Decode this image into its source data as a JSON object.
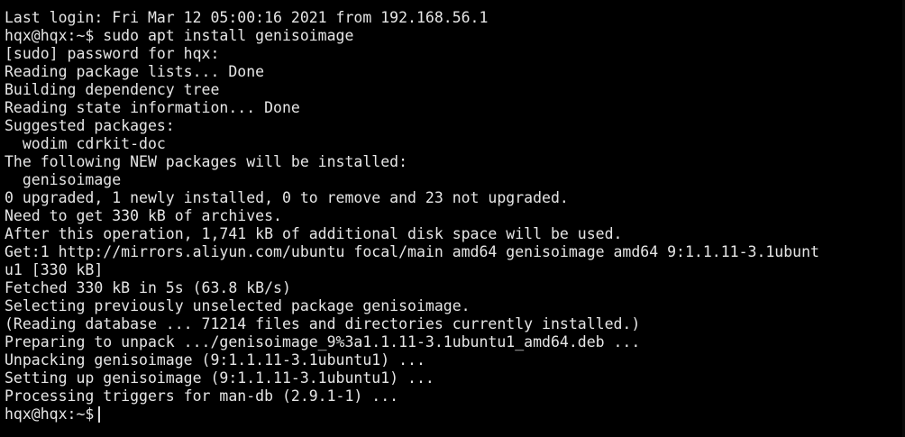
{
  "terminal": {
    "lines": [
      "Last login: Fri Mar 12 05:00:16 2021 from 192.168.56.1",
      "hqx@hqx:~$ sudo apt install genisoimage",
      "[sudo] password for hqx:",
      "Reading package lists... Done",
      "Building dependency tree",
      "Reading state information... Done",
      "Suggested packages:",
      "  wodim cdrkit-doc",
      "The following NEW packages will be installed:",
      "  genisoimage",
      "0 upgraded, 1 newly installed, 0 to remove and 23 not upgraded.",
      "Need to get 330 kB of archives.",
      "After this operation, 1,741 kB of additional disk space will be used.",
      "Get:1 http://mirrors.aliyun.com/ubuntu focal/main amd64 genisoimage amd64 9:1.1.11-3.1ubunt",
      "u1 [330 kB]",
      "Fetched 330 kB in 5s (63.8 kB/s)",
      "Selecting previously unselected package genisoimage.",
      "(Reading database ... 71214 files and directories currently installed.)",
      "Preparing to unpack .../genisoimage_9%3a1.1.11-3.1ubuntu1_amd64.deb ...",
      "Unpacking genisoimage (9:1.1.11-3.1ubuntu1) ...",
      "Setting up genisoimage (9:1.1.11-3.1ubuntu1) ...",
      "Processing triggers for man-db (2.9.1-1) ..."
    ],
    "prompt": "hqx@hqx:~$",
    "colors": {
      "background": "#000000",
      "foreground": "#e6e6e6"
    }
  }
}
